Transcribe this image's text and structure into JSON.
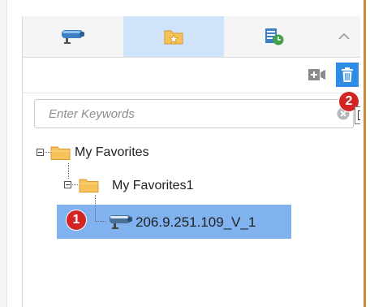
{
  "tabs": [
    {
      "id": "devices",
      "icon": "camera-icon",
      "active": false
    },
    {
      "id": "favorites",
      "icon": "favorites-folder-icon",
      "active": true
    },
    {
      "id": "schedule",
      "icon": "list-clock-icon",
      "active": false
    }
  ],
  "toolbar": {
    "add_icon": "add-camera-icon",
    "delete_icon": "trash-icon"
  },
  "search": {
    "placeholder": "Enter Keywords",
    "value": ""
  },
  "tree": {
    "root_label": "My Favorites",
    "child_label": "My Favorites1",
    "device_label": "206.9.251.109_V_1"
  },
  "badges": {
    "one": "1",
    "two": "2"
  },
  "colors": {
    "active_tab": "#cfe3fb",
    "selected_row": "#7fb2ef",
    "delete_button": "#2f8ce6",
    "badge": "#d32424",
    "folder": "#f6c35a"
  }
}
